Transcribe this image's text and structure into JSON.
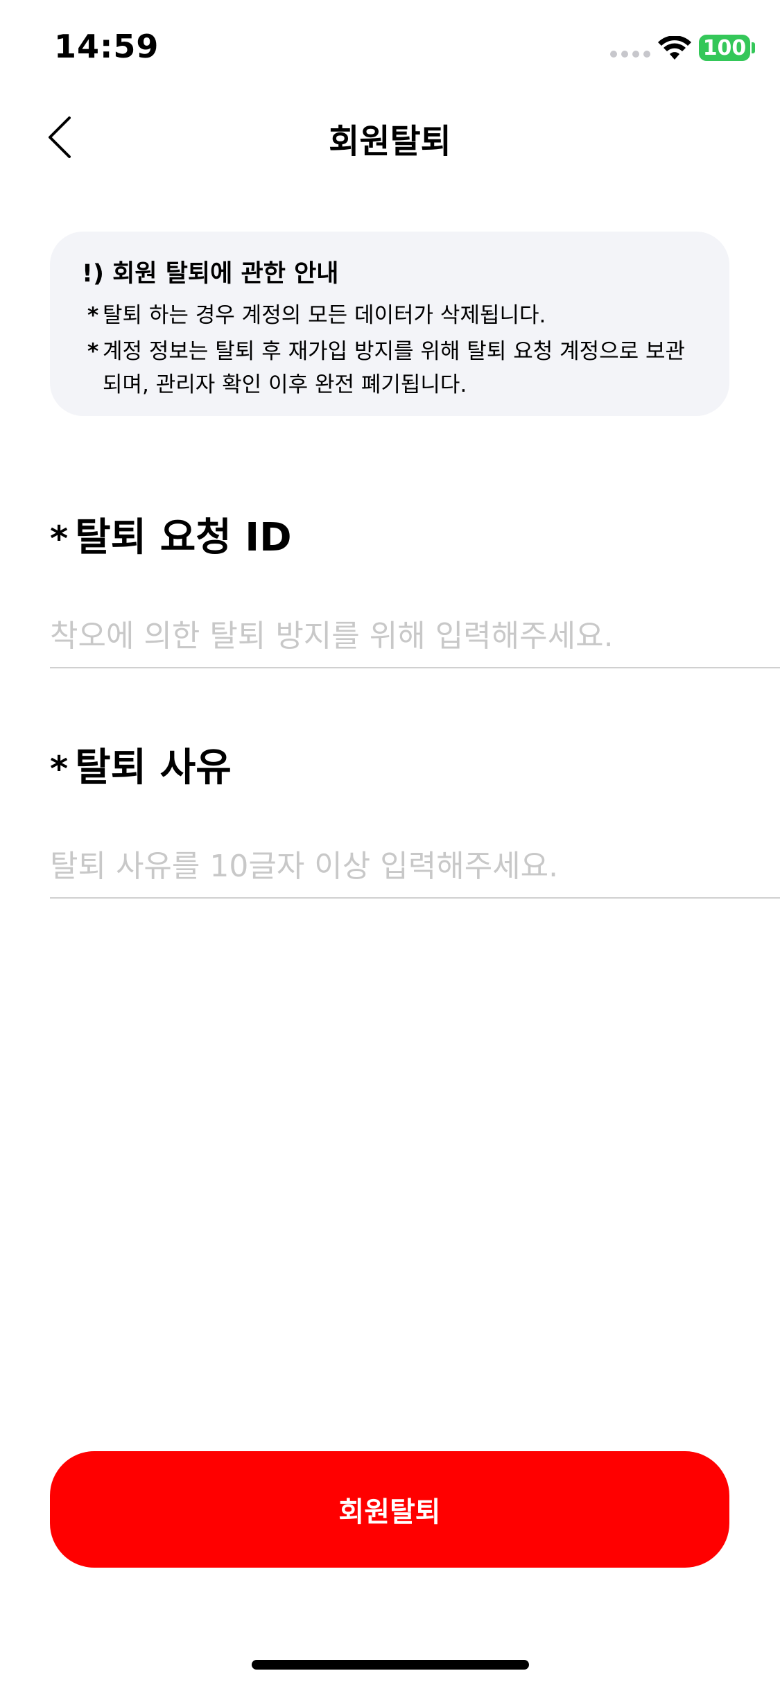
{
  "status_bar": {
    "time": "14:59",
    "battery": "100",
    "battery_color": "#34c759"
  },
  "header": {
    "back_icon": "chevron-left-icon",
    "title": "회원탈퇴"
  },
  "notice": {
    "title": "!) 회원 탈퇴에 관한 안내",
    "items": [
      {
        "bullet": "*",
        "text": "탈퇴 하는 경우 계정의 모든 데이터가 삭제됩니다."
      },
      {
        "bullet": "*",
        "text": "계정 정보는 탈퇴 후 재가입 방지를 위해 탈퇴 요청 계정으로 보관되며, 관리자 확인 이후 완전 폐기됩니다."
      }
    ],
    "background": "#f3f4f8"
  },
  "form": {
    "id_field": {
      "required_mark": "*",
      "label": "탈퇴 요청 ID",
      "value": "",
      "placeholder": "착오에 의한 탈퇴 방지를 위해 입력해주세요."
    },
    "reason_field": {
      "required_mark": "*",
      "label": "탈퇴 사유",
      "value": "",
      "placeholder": "탈퇴 사유를 10글자 이상 입력해주세요."
    }
  },
  "submit": {
    "label": "회원탈퇴",
    "color": "#ff0000"
  }
}
